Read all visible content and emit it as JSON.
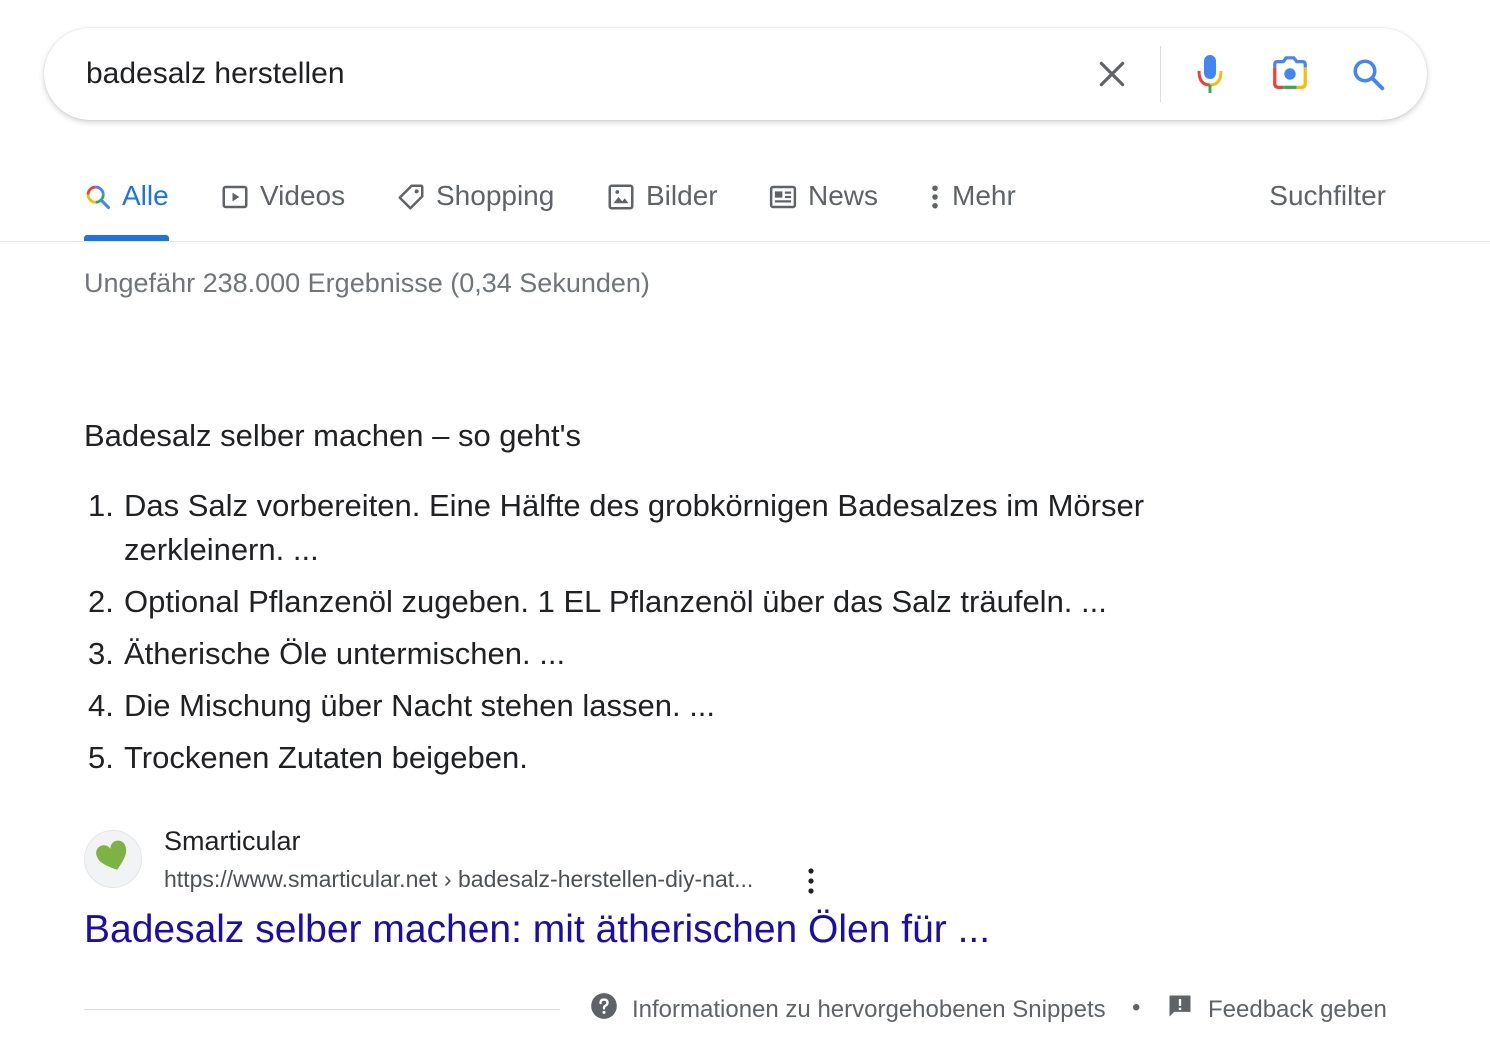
{
  "search": {
    "query": "badesalz herstellen"
  },
  "tabs": [
    {
      "label": "Alle",
      "icon": "search-multicolor-icon",
      "active": true
    },
    {
      "label": "Videos",
      "icon": "play-icon"
    },
    {
      "label": "Shopping",
      "icon": "tag-icon"
    },
    {
      "label": "Bilder",
      "icon": "image-icon"
    },
    {
      "label": "News",
      "icon": "newspaper-icon"
    },
    {
      "label": "Mehr",
      "icon": "more-vertical-icon"
    }
  ],
  "tools_label": "Suchfilter",
  "result_stats": "Ungefähr 238.000 Ergebnisse (0,34 Sekunden)",
  "snippet": {
    "title": "Badesalz selber machen – so geht's",
    "steps": [
      {
        "num": "1.",
        "text": "Das Salz vorbereiten. Eine Hälfte des grobkörnigen Badesalzes im Mörser zerkleinern. ..."
      },
      {
        "num": "2.",
        "text": "Optional Pflanzenöl zugeben. 1 EL Pflanzenöl über das Salz träufeln. ..."
      },
      {
        "num": "3.",
        "text": "Ätherische Öle untermischen. ..."
      },
      {
        "num": "4.",
        "text": "Die Mischung über Nacht stehen lassen. ..."
      },
      {
        "num": "5.",
        "text": "Trockenen Zutaten beigeben."
      }
    ]
  },
  "source": {
    "site_name": "Smarticular",
    "url": "https://www.smarticular.net › badesalz-herstellen-diy-nat...",
    "favicon": "green-heart-icon",
    "favicon_color": "#7cb342"
  },
  "result_title": "Badesalz selber machen: mit ätherischen Ölen für ...",
  "footer": {
    "info_label": "Informationen zu hervorgehobenen Snippets",
    "bullet": "•",
    "feedback_label": "Feedback geben"
  },
  "colors": {
    "accent": "#1a73e8",
    "link": "#1a0dab",
    "muted": "#5f6368"
  }
}
